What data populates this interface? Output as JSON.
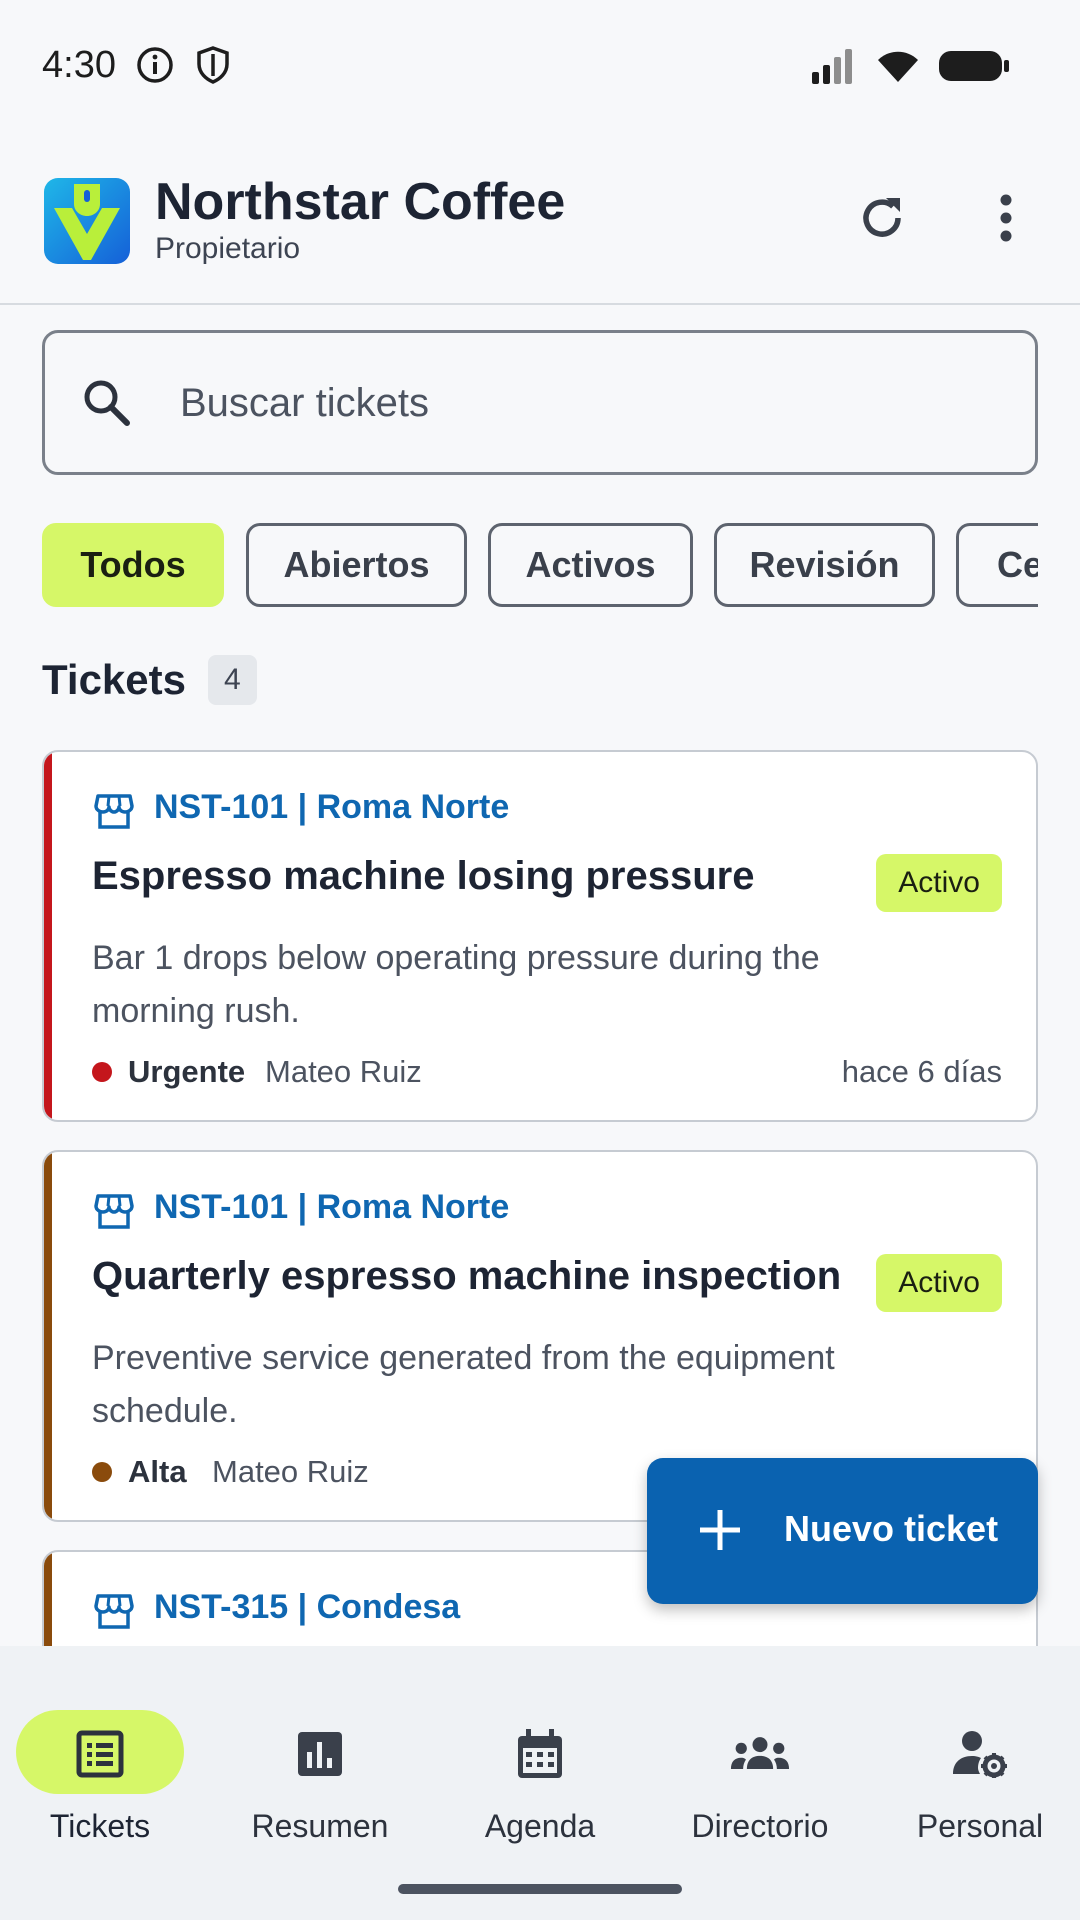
{
  "status_bar": {
    "time": "4:30",
    "icons": [
      "info-icon",
      "shield-icon",
      "signal-icon",
      "wifi-icon",
      "battery-icon"
    ]
  },
  "app_bar": {
    "title": "Northstar Coffee",
    "subtitle": "Propietario",
    "actions": [
      "refresh-icon",
      "more-vert-icon"
    ]
  },
  "search": {
    "placeholder": "Buscar tickets"
  },
  "filters": {
    "chips": [
      "Todos",
      "Abiertos",
      "Activos",
      "Revisión",
      "Ce"
    ],
    "selected": "Todos"
  },
  "tickets_section": {
    "title": "Tickets",
    "count": "4"
  },
  "tickets": [
    {
      "ref": "NST-101 | Roma Norte",
      "title": "Espresso machine losing pressure",
      "status": "Activo",
      "description": "Bar 1 drops below operating pressure during the morning rush.",
      "priority": "Urgente",
      "priority_color": "#c4161c",
      "assignee": "Mateo Ruiz",
      "time": "hace 6 días"
    },
    {
      "ref": "NST-101 | Roma Norte",
      "title": "Quarterly espresso machine inspection",
      "status": "Activo",
      "description": "Preventive service generated from the equipment schedule.",
      "priority": "Alta",
      "priority_color": "#8a4b0c",
      "assignee": "Mateo Ruiz",
      "time": ""
    },
    {
      "ref": "NST-315 | Condesa",
      "priority_color": "#8a4b0c"
    }
  ],
  "fab": {
    "label": "Nuevo ticket"
  },
  "bottom_nav": {
    "items": [
      {
        "label": "Tickets",
        "icon": "list-icon"
      },
      {
        "label": "Resumen",
        "icon": "bar-chart-icon"
      },
      {
        "label": "Agenda",
        "icon": "calendar-icon"
      },
      {
        "label": "Directorio",
        "icon": "groups-icon"
      },
      {
        "label": "Personal",
        "icon": "user-settings-icon"
      }
    ],
    "active": "Tickets"
  },
  "colors": {
    "accent": "#d6f768",
    "primary": "#0a62b0",
    "link": "#0f67b1"
  }
}
